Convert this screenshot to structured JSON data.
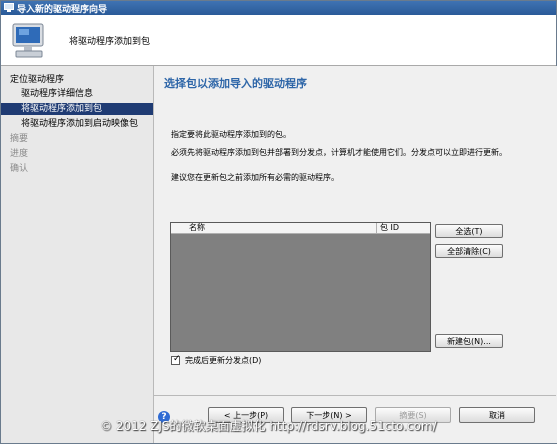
{
  "window": {
    "title": "导入新的驱动程序向导"
  },
  "header": {
    "text": "将驱动程序添加到包"
  },
  "nav": {
    "items": [
      {
        "label": "定位驱动程序"
      },
      {
        "label": "驱动程序详细信息"
      },
      {
        "label": "将驱动程序添加到包"
      },
      {
        "label": "将驱动程序添加到启动映像包"
      },
      {
        "label": "摘要"
      },
      {
        "label": "进度"
      },
      {
        "label": "确认"
      }
    ]
  },
  "main": {
    "title": "选择包以添加导入的驱动程序",
    "line1": "指定要将此驱动程序添加到的包。",
    "line2": "必须先将驱动程序添加到包并部署到分发点，计算机才能使用它们。分发点可以立即进行更新。",
    "line3": "建议您在更新包之前添加所有必需的驱动程序。",
    "list": {
      "col_name": "名称",
      "col_id": "包 ID"
    },
    "buttons": {
      "select_all": "全选(T)",
      "clear_all": "全部清除(C)",
      "new_package": "新建包(N)..."
    },
    "checkbox_label": "完成后更新分发点(D)",
    "checkbox_checked": true
  },
  "footer": {
    "prev": "< 上一步(P)",
    "next": "下一步(N) >",
    "summary": "摘要(S)",
    "cancel": "取消",
    "help": "?"
  },
  "watermark": "© 2012 ZJS的微软桌面虚拟化 http://rdsrv.blog.51cto.com/"
}
